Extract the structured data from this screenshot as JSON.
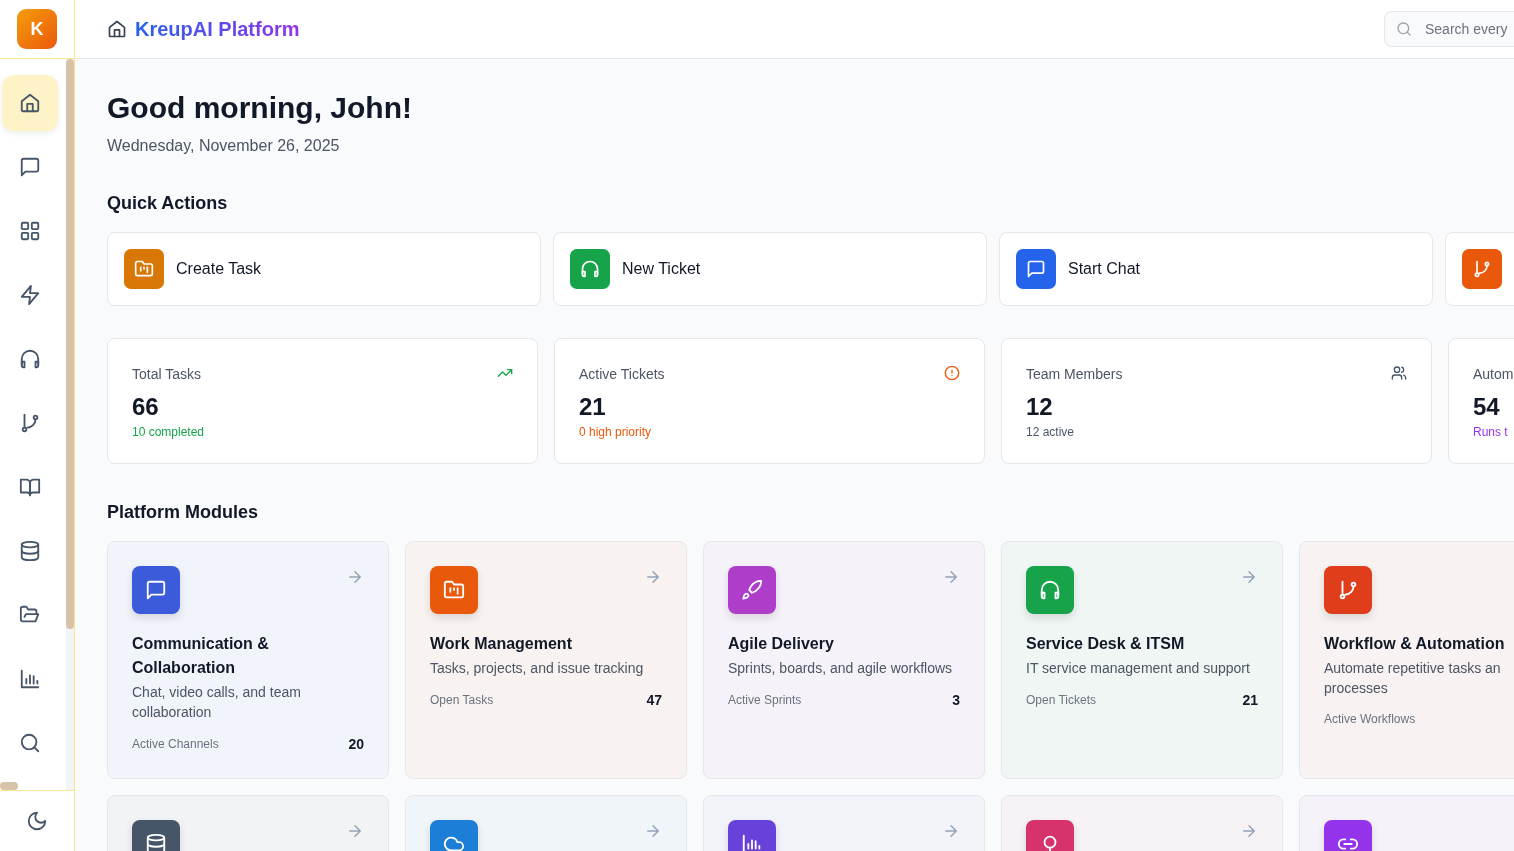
{
  "sidebar": {
    "logo": "K",
    "items": [
      {
        "selected": true
      },
      {
        "selected": false
      },
      {
        "selected": false
      },
      {
        "selected": false
      },
      {
        "selected": false
      },
      {
        "selected": false
      },
      {
        "selected": false
      },
      {
        "selected": false
      },
      {
        "selected": false
      },
      {
        "selected": false
      },
      {
        "selected": false
      }
    ]
  },
  "header": {
    "title": "KreupAI Platform",
    "search": {
      "placeholder": "Search every"
    }
  },
  "greeting": {
    "title": "Good morning, John!",
    "date": "Wednesday, November 26, 2025"
  },
  "quick_actions": {
    "title": "Quick Actions",
    "items": [
      {
        "label": "Create Task",
        "color": "#d97706"
      },
      {
        "label": "New Ticket",
        "color": "#16a34a"
      },
      {
        "label": "Start Chat",
        "color": "#2563eb"
      },
      {
        "color": "#ea580c"
      }
    ]
  },
  "stats": [
    {
      "label": "Total Tasks",
      "value": "66",
      "note": "10 completed",
      "color": "#16a34a"
    },
    {
      "label": "Active Tickets",
      "value": "21",
      "note": "0 high priority",
      "color": "#ea580c"
    },
    {
      "label": "Team Members",
      "value": "12",
      "note": "12 active",
      "color": "#475569"
    },
    {
      "label": "Autom",
      "value": "54",
      "note": "Runs t",
      "color": "#9333ea"
    }
  ],
  "modules": {
    "title": "Platform Modules",
    "items": [
      {
        "title": "Communication & Collaboration",
        "description": "Chat, video calls, and team collaboration",
        "stat_label": "Active Channels",
        "stat_value": "20",
        "color": "#3b5bdb",
        "arrow": true
      },
      {
        "title": "Work Management",
        "description": "Tasks, projects, and issue tracking",
        "stat_label": "Open Tasks",
        "stat_value": "47",
        "color": "#e8590c",
        "arrow": true
      },
      {
        "title": "Agile Delivery",
        "description": "Sprints, boards, and agile workflows",
        "stat_label": "Active Sprints",
        "stat_value": "3",
        "color": "#ae3ec9",
        "arrow": true
      },
      {
        "title": "Service Desk & ITSM",
        "description": "IT service management and support",
        "stat_label": "Open Tickets",
        "stat_value": "21",
        "color": "#16a34a",
        "arrow": true
      },
      {
        "title": "Workflow & Automation",
        "description": "Automate repetitive tasks an processes",
        "stat_label": "Active Workflows",
        "color": "#e03e1a",
        "arrow": false
      },
      {
        "color": "#475569",
        "arrow": true
      },
      {
        "color": "#1c7ed6",
        "arrow": true
      },
      {
        "color": "#6741d9",
        "arrow": true
      },
      {
        "color": "#d6336c",
        "arrow": true
      },
      {
        "color": "#9333ea",
        "arrow": false
      }
    ]
  }
}
